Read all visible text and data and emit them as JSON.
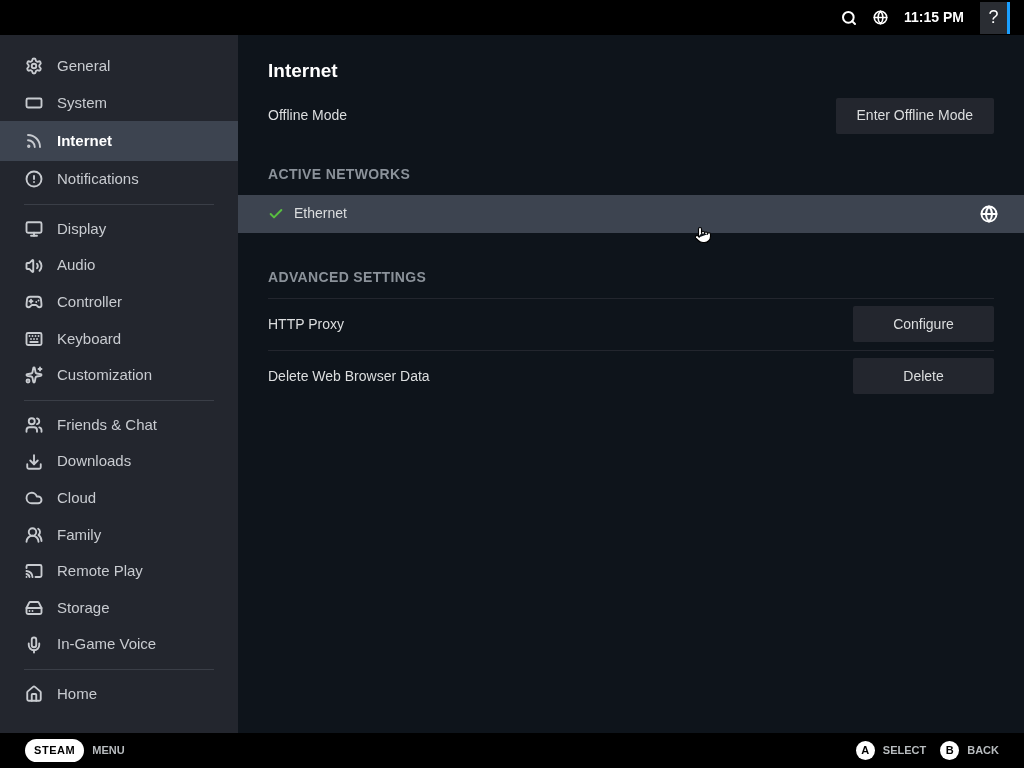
{
  "top_bar": {
    "time": "11:15 PM",
    "help": "?"
  },
  "sidebar": {
    "groups": [
      [
        {
          "label": "General",
          "selected": false
        },
        {
          "label": "System",
          "selected": false
        },
        {
          "label": "Internet",
          "selected": true
        },
        {
          "label": "Notifications",
          "selected": false
        }
      ],
      [
        {
          "label": "Display",
          "selected": false
        },
        {
          "label": "Audio",
          "selected": false
        },
        {
          "label": "Controller",
          "selected": false
        },
        {
          "label": "Keyboard",
          "selected": false
        },
        {
          "label": "Customization",
          "selected": false
        }
      ],
      [
        {
          "label": "Friends & Chat",
          "selected": false
        },
        {
          "label": "Downloads",
          "selected": false
        },
        {
          "label": "Cloud",
          "selected": false
        },
        {
          "label": "Family",
          "selected": false
        },
        {
          "label": "Remote Play",
          "selected": false
        },
        {
          "label": "Storage",
          "selected": false
        },
        {
          "label": "In-Game Voice",
          "selected": false
        }
      ],
      [
        {
          "label": "Home",
          "selected": false
        }
      ]
    ]
  },
  "page": {
    "title": "Internet",
    "offline": {
      "label": "Offline Mode",
      "button": "Enter Offline Mode"
    },
    "active_networks": {
      "heading": "ACTIVE NETWORKS",
      "networks": [
        {
          "name": "Ethernet",
          "connected": true
        }
      ]
    },
    "advanced": {
      "heading": "ADVANCED SETTINGS",
      "rows": [
        {
          "label": "HTTP Proxy",
          "button": "Configure"
        },
        {
          "label": "Delete Web Browser Data",
          "button": "Delete"
        }
      ]
    }
  },
  "footer": {
    "steam": "STEAM",
    "menu": "MENU",
    "actions": [
      {
        "key": "A",
        "label": "SELECT"
      },
      {
        "key": "B",
        "label": "BACK"
      }
    ]
  }
}
